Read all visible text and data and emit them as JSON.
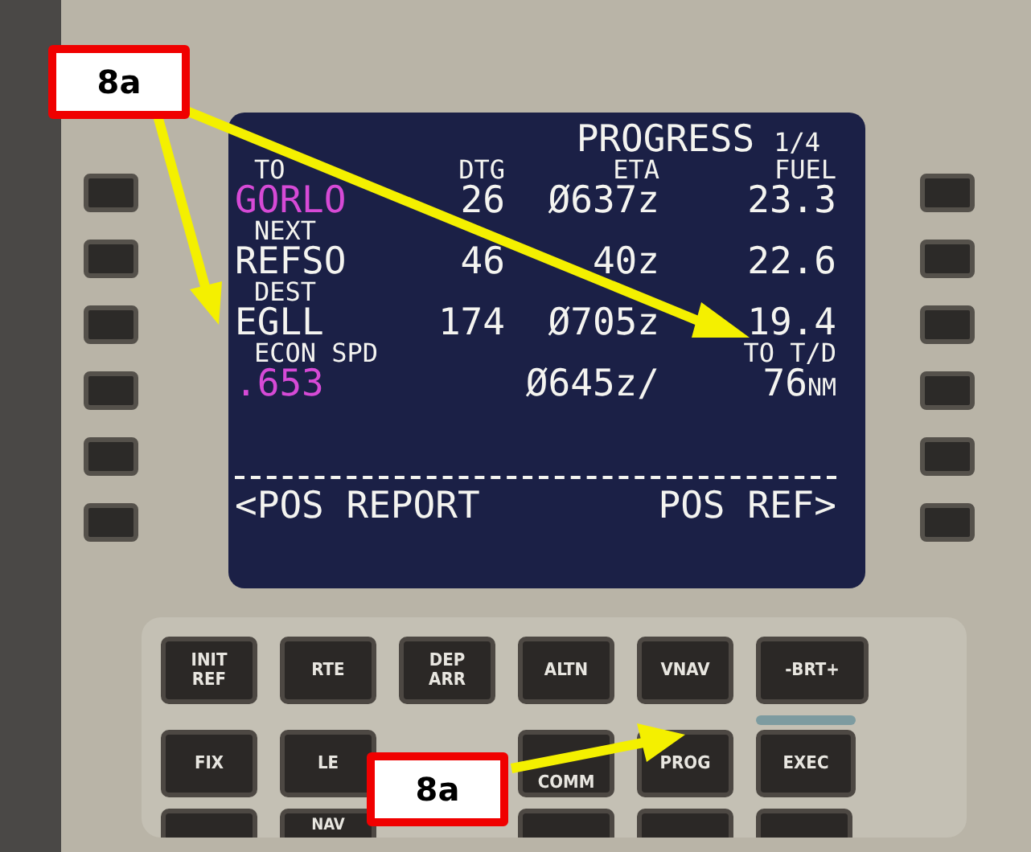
{
  "screen": {
    "title": "PROGRESS",
    "page": "1/4",
    "columns": [
      "DTG",
      "ETA",
      "FUEL"
    ],
    "rows": [
      {
        "kind": "waypoint",
        "label": "TO",
        "name": "GORLO",
        "color": "#d64ad6",
        "dtg": "26",
        "eta": "Ø637z",
        "fuel": "23.3"
      },
      {
        "kind": "waypoint",
        "label": "NEXT",
        "name": "REFSO",
        "color": "#f4f4f0",
        "dtg": "46",
        "eta": "40z",
        "fuel": "22.6"
      },
      {
        "kind": "waypoint",
        "label": "DEST",
        "name": "EGLL",
        "color": "#f4f4f0",
        "dtg": "174",
        "eta": "Ø705z",
        "fuel": "19.4"
      },
      {
        "kind": "speed",
        "label": "ECON SPD",
        "value": ".653",
        "color": "#d64ad6",
        "eta": "Ø645z/",
        "right_label": "TO T/D",
        "distance": "76",
        "unit": "NM"
      }
    ],
    "left_prompt": "<POS REPORT",
    "right_prompt": "POS REF>"
  },
  "keys": [
    [
      {
        "label": "INIT REF",
        "kind": "mode"
      },
      {
        "label": "RTE",
        "kind": "mode"
      },
      {
        "label": "DEP ARR",
        "kind": "mode"
      },
      {
        "label": "ALTN",
        "kind": "mode"
      },
      {
        "label": "VNAV",
        "kind": "mode"
      },
      {
        "label": "-BRT+",
        "kind": "rocker"
      }
    ],
    [
      {
        "label": "FIX",
        "kind": "mode"
      },
      {
        "label": "LE",
        "kind": "mode"
      },
      {
        "kind": "hidden"
      },
      {
        "label": "COMM",
        "kind": "lower"
      },
      {
        "label": "PROG",
        "kind": "mode"
      },
      {
        "label": "EXEC",
        "kind": "exec"
      }
    ],
    [
      {
        "kind": "stub"
      },
      {
        "label": "NAV",
        "kind": "stub"
      },
      {
        "kind": "hidden"
      },
      {
        "kind": "stub"
      },
      {
        "kind": "stub"
      },
      {
        "kind": "stub"
      }
    ]
  ],
  "callouts": [
    {
      "label": "8a"
    },
    {
      "label": "8a"
    }
  ]
}
